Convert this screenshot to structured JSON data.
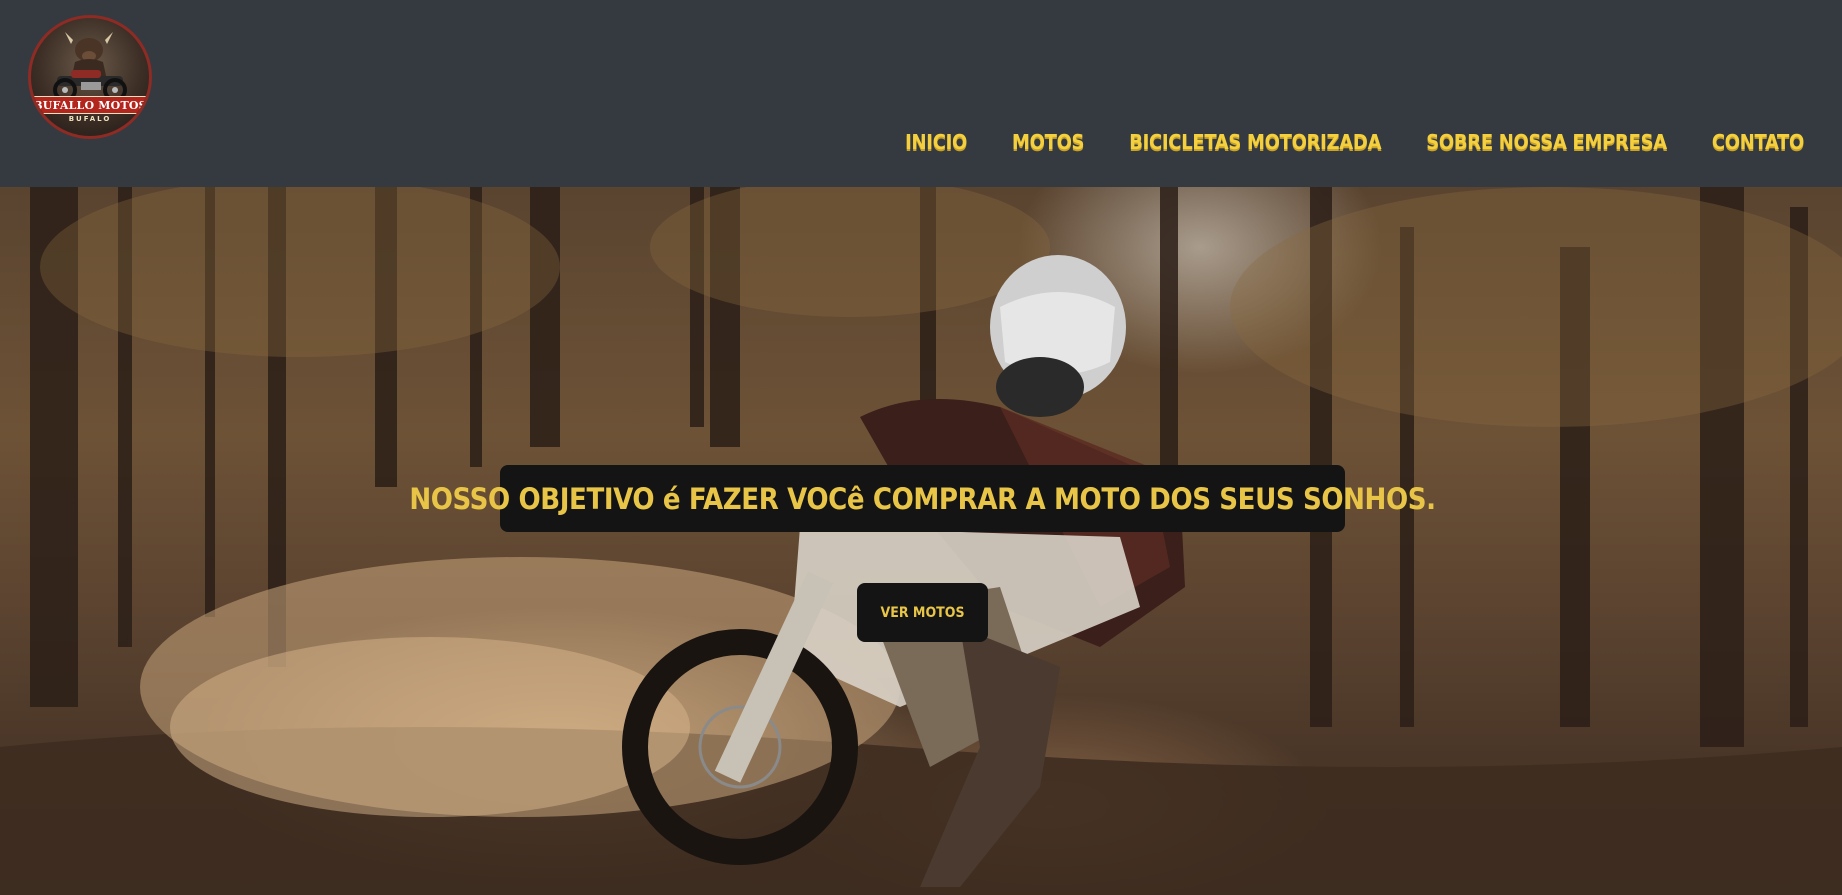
{
  "brand": {
    "logo_text": "BUFALLO MOTOS",
    "logo_subtext": "BUFALO"
  },
  "nav": {
    "items": [
      {
        "label": "INICIO"
      },
      {
        "label": "MOTOS"
      },
      {
        "label": "BICICLETAS MOTORIZADA"
      },
      {
        "label": "SOBRE NOSSA EMPRESA"
      },
      {
        "label": "CONTATO"
      }
    ]
  },
  "hero": {
    "headline": "NOSSO OBJETIVO é FAZER VOCê COMPRAR A MOTO DOS SEUS SONHOS.",
    "cta_label": "VER MOTOS"
  },
  "colors": {
    "header_bg": "#343a40",
    "accent_yellow": "#f4d03f",
    "box_bg": "#141414",
    "logo_red": "#b3261e"
  }
}
